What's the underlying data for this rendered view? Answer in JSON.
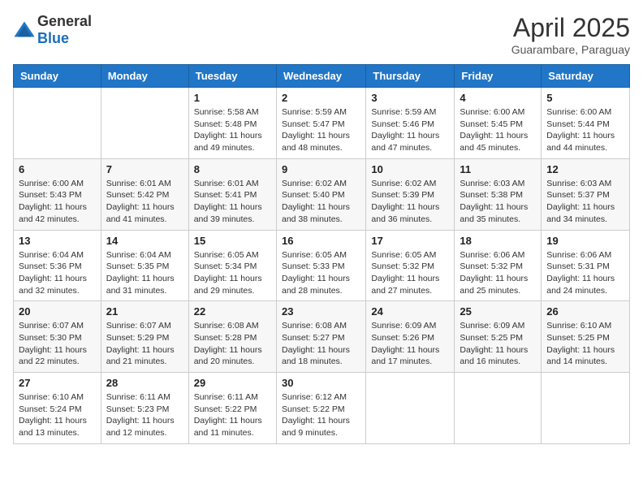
{
  "header": {
    "logo_general": "General",
    "logo_blue": "Blue",
    "month_title": "April 2025",
    "subtitle": "Guarambare, Paraguay"
  },
  "weekdays": [
    "Sunday",
    "Monday",
    "Tuesday",
    "Wednesday",
    "Thursday",
    "Friday",
    "Saturday"
  ],
  "weeks": [
    [
      {
        "day": "",
        "info": ""
      },
      {
        "day": "",
        "info": ""
      },
      {
        "day": "1",
        "info": "Sunrise: 5:58 AM\nSunset: 5:48 PM\nDaylight: 11 hours and 49 minutes."
      },
      {
        "day": "2",
        "info": "Sunrise: 5:59 AM\nSunset: 5:47 PM\nDaylight: 11 hours and 48 minutes."
      },
      {
        "day": "3",
        "info": "Sunrise: 5:59 AM\nSunset: 5:46 PM\nDaylight: 11 hours and 47 minutes."
      },
      {
        "day": "4",
        "info": "Sunrise: 6:00 AM\nSunset: 5:45 PM\nDaylight: 11 hours and 45 minutes."
      },
      {
        "day": "5",
        "info": "Sunrise: 6:00 AM\nSunset: 5:44 PM\nDaylight: 11 hours and 44 minutes."
      }
    ],
    [
      {
        "day": "6",
        "info": "Sunrise: 6:00 AM\nSunset: 5:43 PM\nDaylight: 11 hours and 42 minutes."
      },
      {
        "day": "7",
        "info": "Sunrise: 6:01 AM\nSunset: 5:42 PM\nDaylight: 11 hours and 41 minutes."
      },
      {
        "day": "8",
        "info": "Sunrise: 6:01 AM\nSunset: 5:41 PM\nDaylight: 11 hours and 39 minutes."
      },
      {
        "day": "9",
        "info": "Sunrise: 6:02 AM\nSunset: 5:40 PM\nDaylight: 11 hours and 38 minutes."
      },
      {
        "day": "10",
        "info": "Sunrise: 6:02 AM\nSunset: 5:39 PM\nDaylight: 11 hours and 36 minutes."
      },
      {
        "day": "11",
        "info": "Sunrise: 6:03 AM\nSunset: 5:38 PM\nDaylight: 11 hours and 35 minutes."
      },
      {
        "day": "12",
        "info": "Sunrise: 6:03 AM\nSunset: 5:37 PM\nDaylight: 11 hours and 34 minutes."
      }
    ],
    [
      {
        "day": "13",
        "info": "Sunrise: 6:04 AM\nSunset: 5:36 PM\nDaylight: 11 hours and 32 minutes."
      },
      {
        "day": "14",
        "info": "Sunrise: 6:04 AM\nSunset: 5:35 PM\nDaylight: 11 hours and 31 minutes."
      },
      {
        "day": "15",
        "info": "Sunrise: 6:05 AM\nSunset: 5:34 PM\nDaylight: 11 hours and 29 minutes."
      },
      {
        "day": "16",
        "info": "Sunrise: 6:05 AM\nSunset: 5:33 PM\nDaylight: 11 hours and 28 minutes."
      },
      {
        "day": "17",
        "info": "Sunrise: 6:05 AM\nSunset: 5:32 PM\nDaylight: 11 hours and 27 minutes."
      },
      {
        "day": "18",
        "info": "Sunrise: 6:06 AM\nSunset: 5:32 PM\nDaylight: 11 hours and 25 minutes."
      },
      {
        "day": "19",
        "info": "Sunrise: 6:06 AM\nSunset: 5:31 PM\nDaylight: 11 hours and 24 minutes."
      }
    ],
    [
      {
        "day": "20",
        "info": "Sunrise: 6:07 AM\nSunset: 5:30 PM\nDaylight: 11 hours and 22 minutes."
      },
      {
        "day": "21",
        "info": "Sunrise: 6:07 AM\nSunset: 5:29 PM\nDaylight: 11 hours and 21 minutes."
      },
      {
        "day": "22",
        "info": "Sunrise: 6:08 AM\nSunset: 5:28 PM\nDaylight: 11 hours and 20 minutes."
      },
      {
        "day": "23",
        "info": "Sunrise: 6:08 AM\nSunset: 5:27 PM\nDaylight: 11 hours and 18 minutes."
      },
      {
        "day": "24",
        "info": "Sunrise: 6:09 AM\nSunset: 5:26 PM\nDaylight: 11 hours and 17 minutes."
      },
      {
        "day": "25",
        "info": "Sunrise: 6:09 AM\nSunset: 5:25 PM\nDaylight: 11 hours and 16 minutes."
      },
      {
        "day": "26",
        "info": "Sunrise: 6:10 AM\nSunset: 5:25 PM\nDaylight: 11 hours and 14 minutes."
      }
    ],
    [
      {
        "day": "27",
        "info": "Sunrise: 6:10 AM\nSunset: 5:24 PM\nDaylight: 11 hours and 13 minutes."
      },
      {
        "day": "28",
        "info": "Sunrise: 6:11 AM\nSunset: 5:23 PM\nDaylight: 11 hours and 12 minutes."
      },
      {
        "day": "29",
        "info": "Sunrise: 6:11 AM\nSunset: 5:22 PM\nDaylight: 11 hours and 11 minutes."
      },
      {
        "day": "30",
        "info": "Sunrise: 6:12 AM\nSunset: 5:22 PM\nDaylight: 11 hours and 9 minutes."
      },
      {
        "day": "",
        "info": ""
      },
      {
        "day": "",
        "info": ""
      },
      {
        "day": "",
        "info": ""
      }
    ]
  ]
}
